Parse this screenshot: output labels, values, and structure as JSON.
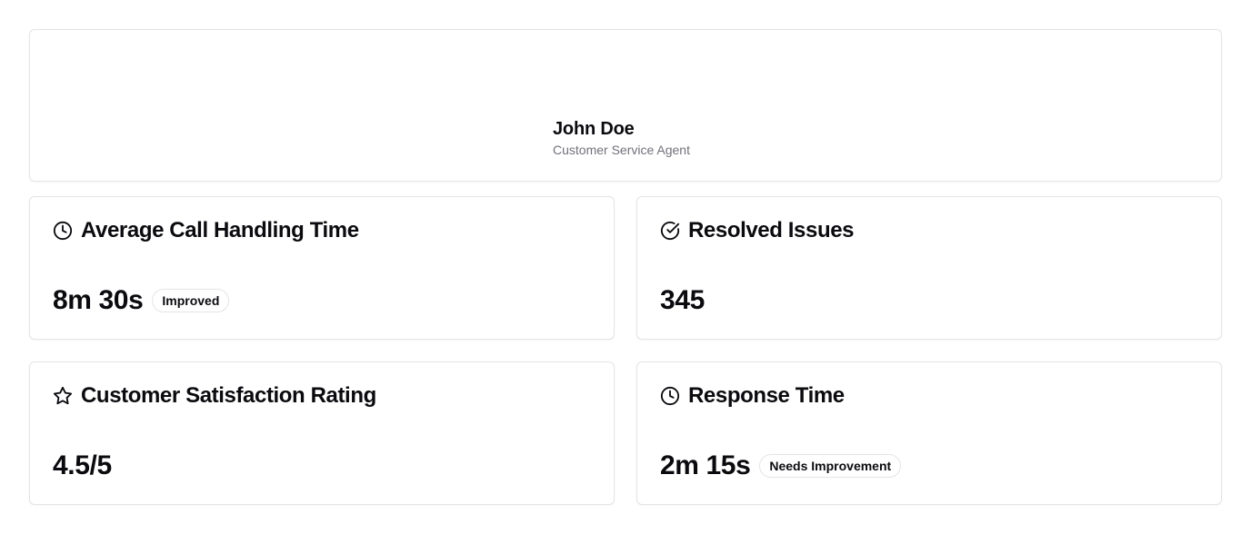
{
  "profile": {
    "name": "John Doe",
    "role": "Customer Service Agent"
  },
  "metrics": [
    {
      "title": "Average Call Handling Time",
      "icon": "clock-icon",
      "value": "8m 30s",
      "badge": "Improved"
    },
    {
      "title": "Resolved Issues",
      "icon": "check-circle-icon",
      "value": "345",
      "badge": ""
    },
    {
      "title": "Customer Satisfaction Rating",
      "icon": "star-icon",
      "value": "4.5/5",
      "badge": ""
    },
    {
      "title": "Response Time",
      "icon": "clock-icon",
      "value": "2m 15s",
      "badge": "Needs Improvement"
    }
  ],
  "colors": {
    "text": "#0b0b0f",
    "muted": "#71717a",
    "border": "#e4e4e7",
    "background": "#ffffff"
  }
}
